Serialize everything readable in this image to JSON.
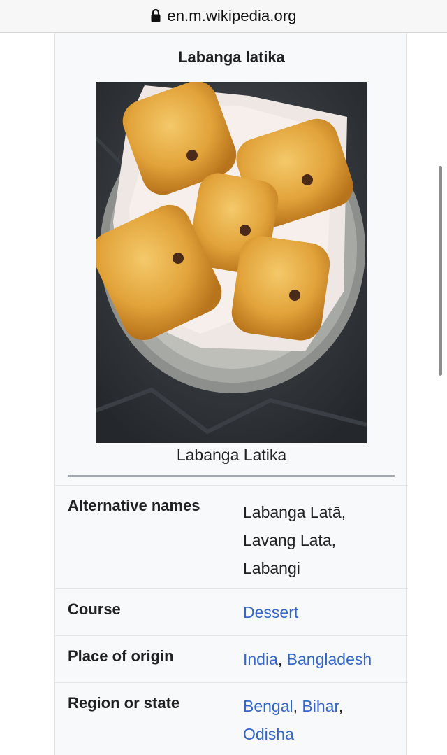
{
  "browser": {
    "url": "en.m.wikipedia.org"
  },
  "infobox": {
    "title": "Labanga latika",
    "image_caption": "Labanga Latika",
    "rows": [
      {
        "label": "Alternative names",
        "values": [
          "Labanga Latā,",
          "Lavang Lata,",
          "Labangi"
        ]
      },
      {
        "label": "Course",
        "links": [
          "Dessert"
        ]
      },
      {
        "label": "Place of origin",
        "links": [
          "India",
          "Bangladesh"
        ],
        "separator": ", "
      },
      {
        "label": "Region or state",
        "links": [
          "Bengal",
          "Bihar",
          "Odisha"
        ],
        "separator": ", "
      }
    ]
  },
  "colors": {
    "link": "#3366cc",
    "text": "#202122",
    "infobox_bg": "#f8f9fa"
  }
}
